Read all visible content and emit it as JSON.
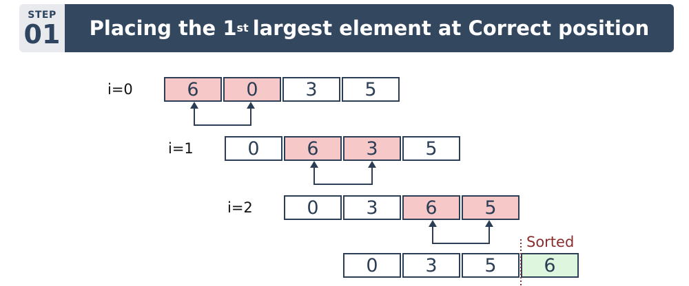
{
  "step": {
    "label": "STEP",
    "number": "01"
  },
  "title": {
    "prefix": "Placing the 1",
    "superscript": "st",
    "suffix": "largest element at Correct position"
  },
  "rows": [
    {
      "label": "i=0",
      "values": [
        "6",
        "0",
        "3",
        "5"
      ],
      "highlight": [
        0,
        1
      ]
    },
    {
      "label": "i=1",
      "values": [
        "0",
        "6",
        "3",
        "5"
      ],
      "highlight": [
        1,
        2
      ]
    },
    {
      "label": "i=2",
      "values": [
        "0",
        "3",
        "6",
        "5"
      ],
      "highlight": [
        2,
        3
      ]
    },
    {
      "label": "",
      "values": [
        "0",
        "3",
        "5",
        "6"
      ],
      "sorted": [
        3
      ]
    }
  ],
  "sorted_label": "Sorted",
  "colors": {
    "swap_highlight": "#f7c8c8",
    "sorted_highlight": "#def5de",
    "title_bar": "#33475f",
    "cell_border": "#2c3e55",
    "sorted_text": "#8b2d2d"
  }
}
